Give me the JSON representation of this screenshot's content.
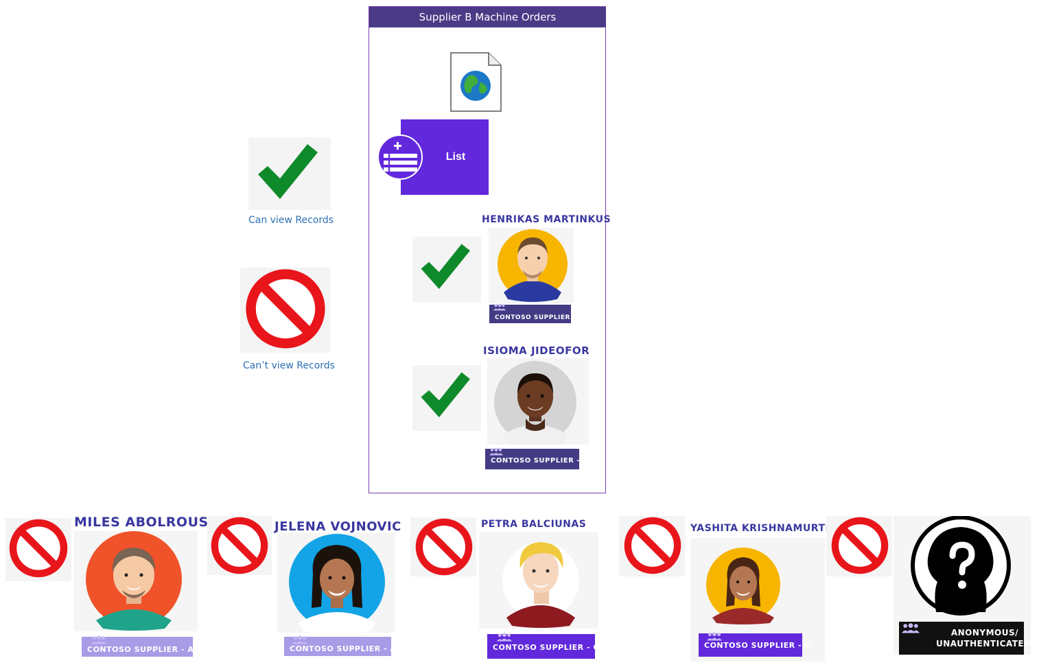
{
  "panel": {
    "title": "Supplier B Machine Orders",
    "list_label": "List"
  },
  "legend": {
    "can_view": "Can view Records",
    "cant_view": "Can’t view Records"
  },
  "authorized_users": [
    {
      "name": "HENRIKAS MARTINKUS",
      "group": "CONTOSO SUPPLIER - B",
      "access": "allowed"
    },
    {
      "name": "ISIOMA JIDEOFOR",
      "group": "CONTOSO SUPPLIER - B",
      "access": "allowed"
    }
  ],
  "denied_users": [
    {
      "name": "MILES ABOLROUS",
      "group": "CONTOSO SUPPLIER - A",
      "access": "denied"
    },
    {
      "name": "JELENA VOJNOVIC",
      "group": "CONTOSO SUPPLIER - A",
      "access": "denied"
    },
    {
      "name": "PETRA BALCIUNAS",
      "group": "CONTOSO SUPPLIER - C",
      "access": "denied"
    },
    {
      "name": "YASHITA KRISHNAMURTI",
      "group": "CONTOSO SUPPLIER - C",
      "access": "denied"
    },
    {
      "name": "",
      "group": "ANONYMOUS/ UNAUTHENTICATED",
      "access": "denied"
    }
  ],
  "icons": {
    "allowed": "checkmark-icon",
    "denied": "prohibited-icon",
    "web_page": "web-page-globe-icon",
    "list": "list-add-icon",
    "group": "group-icon",
    "anonymous": "anonymous-question-icon"
  },
  "colors": {
    "header": "#4b3a86",
    "list_tile": "#6128dc",
    "supplier_a_badge": "#a99be6",
    "supplier_b_badge": "#433b84",
    "supplier_c_badge": "#6128dc",
    "anonymous_badge": "#111111",
    "check_green": "#0f8a2b",
    "deny_red": "#e8151b",
    "legend_text": "#2d6fb4",
    "name_text": "#3a37a0"
  }
}
